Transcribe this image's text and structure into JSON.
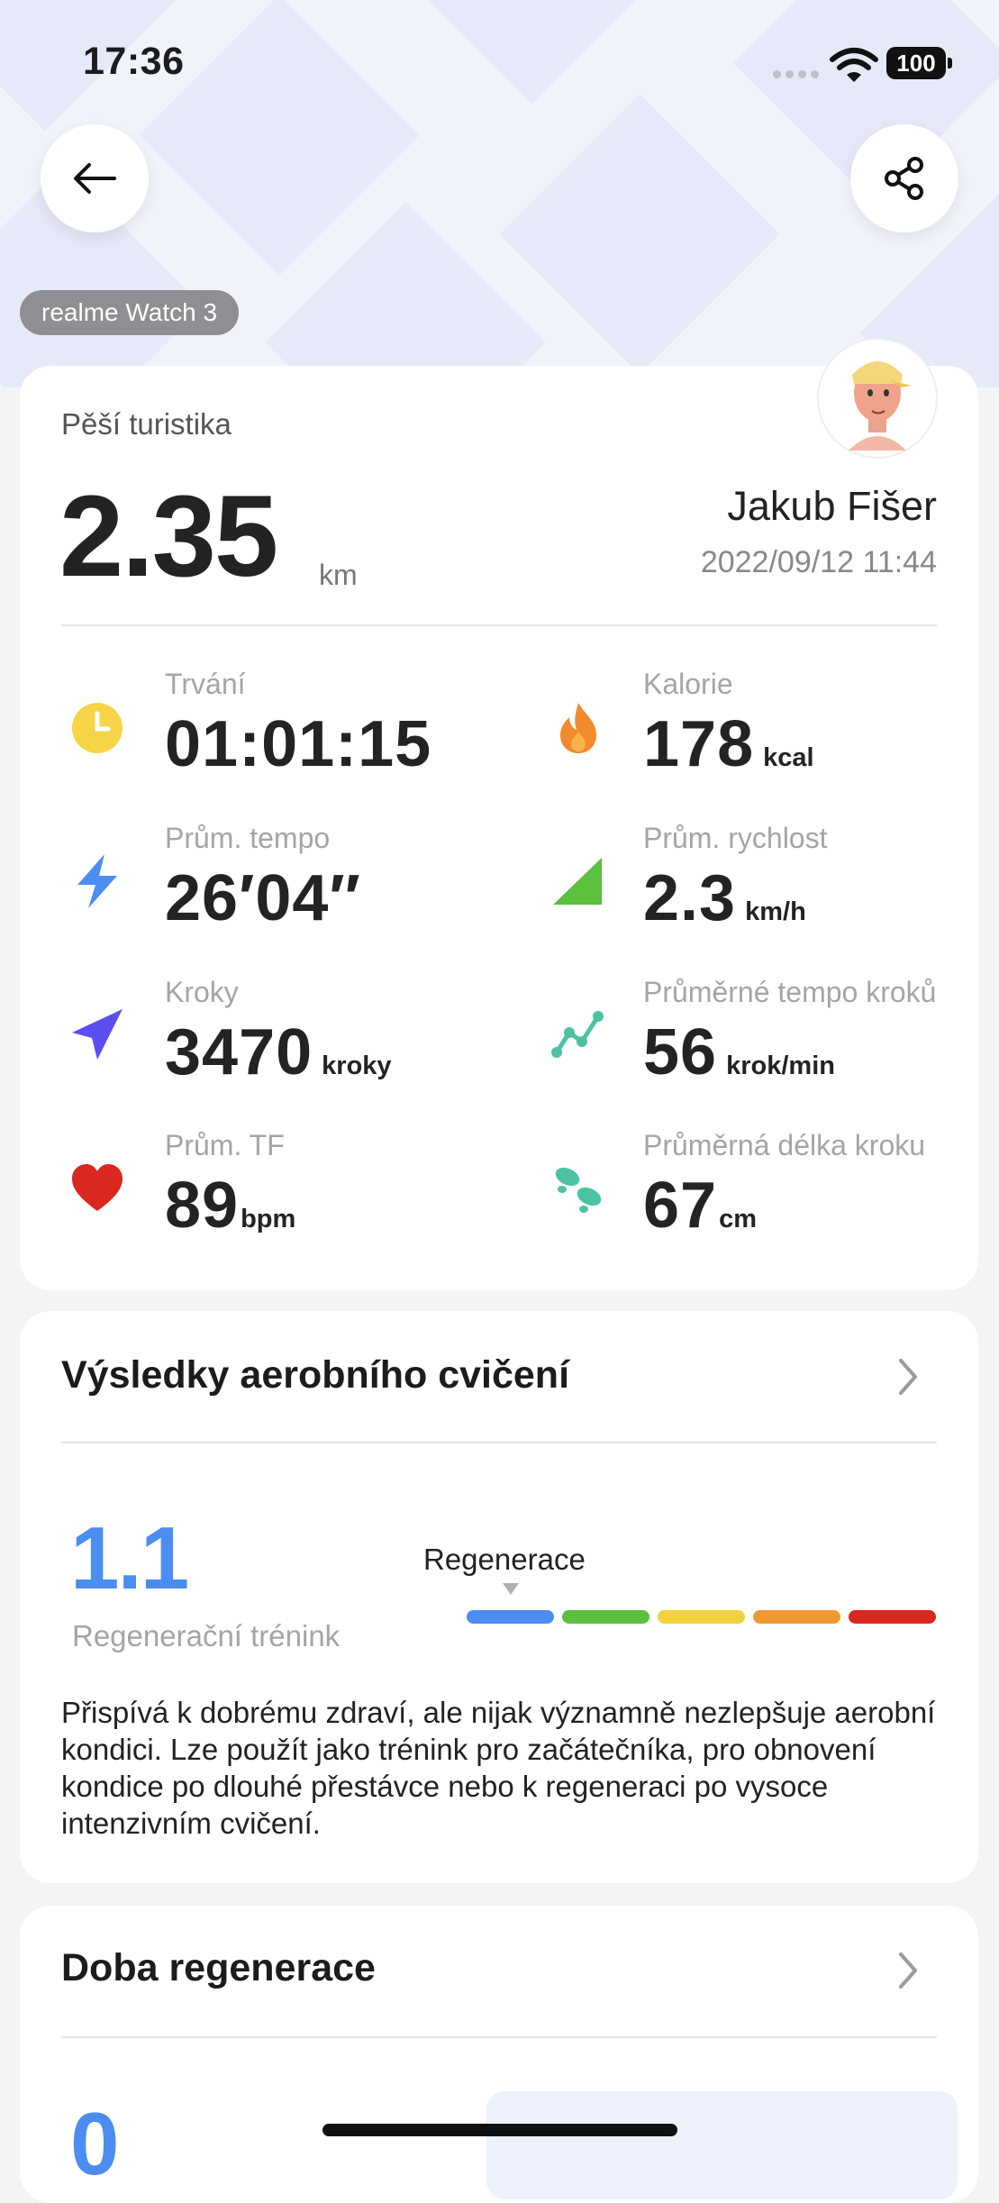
{
  "status_bar": {
    "time": "17:36",
    "battery": "100"
  },
  "header": {
    "back_icon": "arrow-left-icon",
    "share_icon": "share-icon",
    "device_badge": "realme Watch 3"
  },
  "summary": {
    "sport_name": "Pěší turistika",
    "distance": "2.35",
    "distance_unit": "km",
    "user_name": "Jakub Fišer",
    "date_time": "2022/09/12 11:44",
    "metrics": [
      {
        "icon": "clock-icon",
        "label": "Trvání",
        "value": "01:01:15",
        "unit": ""
      },
      {
        "icon": "flame-icon",
        "label": "Kalorie",
        "value": "178",
        "unit": "kcal"
      },
      {
        "icon": "lightning-icon",
        "label": "Prům. tempo",
        "value": "26′04″",
        "unit": ""
      },
      {
        "icon": "speed-ramp-icon",
        "label": "Prům. rychlost",
        "value": "2.3",
        "unit": "km/h"
      },
      {
        "icon": "navigation-arrow-icon",
        "label": "Kroky",
        "value": "3470",
        "unit": "kroky"
      },
      {
        "icon": "cadence-graph-icon",
        "label": "Průměrné tempo kroků",
        "value": "56",
        "unit": "krok/min"
      },
      {
        "icon": "heart-icon",
        "label": "Prům. TF",
        "value": "89",
        "unit": "bpm"
      },
      {
        "icon": "footprints-icon",
        "label": "Průměrná délka kroku",
        "value": "67",
        "unit": "cm"
      }
    ]
  },
  "aerobic": {
    "title": "Výsledky aerobního cvičení",
    "score": "1.1",
    "score_label": "Regenerační trénink",
    "scale_label": "Regenerace",
    "scale_colors": [
      "#4b8df1",
      "#5cbf3d",
      "#f2d23c",
      "#ee9a30",
      "#d9281f"
    ],
    "description": "Přispívá k dobrému zdraví, ale nijak významně nezlepšuje aerobní kondici. Lze použít jako trénink pro začátečníka, pro obnovení kondice po dlouhé přestávce nebo k regeneraci po vysoce intenzivním cvičení."
  },
  "regeneration": {
    "title": "Doba regenerace",
    "value": "0"
  }
}
